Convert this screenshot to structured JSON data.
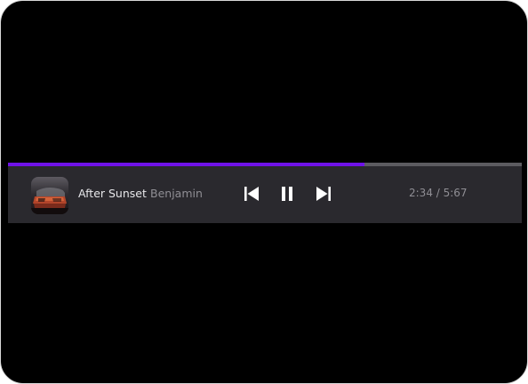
{
  "player": {
    "track_title": "After Sunset",
    "artist": "Benjamin",
    "time_display": "2:34 / 5:67",
    "progress": 0.694,
    "controls": {
      "previous_icon": "skip-previous-icon",
      "pause_icon": "pause-icon",
      "next_icon": "skip-next-icon"
    },
    "album_art": "album-art",
    "colors": {
      "accent": "#6f12e8",
      "bar_background": "#2a292e",
      "track_remaining": "#5c5b60",
      "screen_background": "#000000"
    }
  }
}
